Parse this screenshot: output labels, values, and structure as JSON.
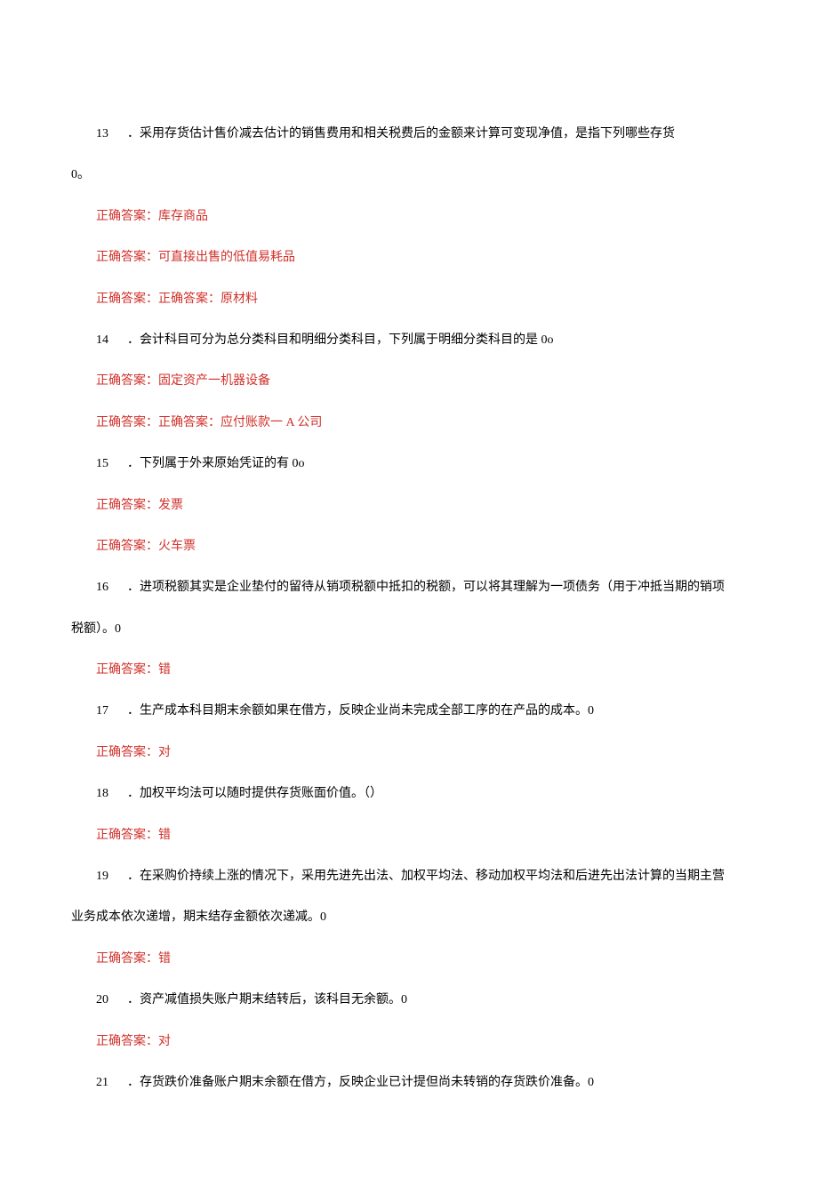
{
  "items": [
    {
      "type": "question",
      "num": "13",
      "text": "．采用存货估计售价减去估计的销售费用和相关税费后的金额来计算可变现净值，是指下列哪些存货",
      "cont": "0。"
    },
    {
      "type": "answer",
      "text": "正确答案：库存商品"
    },
    {
      "type": "answer",
      "text": "正确答案：可直接出售的低值易耗品"
    },
    {
      "type": "answer",
      "text": "正确答案：正确答案：原材料"
    },
    {
      "type": "question",
      "num": "14",
      "text": "．会计科目可分为总分类科目和明细分类科目，下列属于明细分类科目的是 0o"
    },
    {
      "type": "answer",
      "text": "正确答案：固定资产一机器设备"
    },
    {
      "type": "answer",
      "text": "正确答案：正确答案：应付账款一 A 公司"
    },
    {
      "type": "question",
      "num": "15",
      "text": "．下列属于外来原始凭证的有 0o"
    },
    {
      "type": "answer",
      "text": "正确答案：发票"
    },
    {
      "type": "answer",
      "text": "正确答案：火车票"
    },
    {
      "type": "question",
      "num": "16",
      "text": "．进项税额其实是企业垫付的留待从销项税额中抵扣的税额，可以将其理解为一项债务（用于冲抵当期的销项",
      "cont": "税额）。0"
    },
    {
      "type": "answer",
      "text": "正确答案：错"
    },
    {
      "type": "question",
      "num": "17",
      "text": "．生产成本科目期末余额如果在借方，反映企业尚未完成全部工序的在产品的成本。0"
    },
    {
      "type": "answer",
      "text": "正确答案：对"
    },
    {
      "type": "question",
      "num": "18",
      "text": "．加权平均法可以随时提供存货账面价值。（）"
    },
    {
      "type": "answer",
      "text": "正确答案：错"
    },
    {
      "type": "question",
      "num": "19",
      "text": "．在采购价持续上涨的情况下，采用先进先出法、加权平均法、移动加权平均法和后进先出法计算的当期主营",
      "cont": "业务成本依次递增，期末结存金额依次递减。0"
    },
    {
      "type": "answer",
      "text": "正确答案：错"
    },
    {
      "type": "question",
      "num": "20",
      "text": "．资产减值损失账户期末结转后，该科目无余额。0"
    },
    {
      "type": "answer",
      "text": "正确答案：对"
    },
    {
      "type": "question",
      "num": "21",
      "text": "．存货跌价准备账户期末余额在借方，反映企业已计提但尚未转销的存货跌价准备。0"
    }
  ]
}
